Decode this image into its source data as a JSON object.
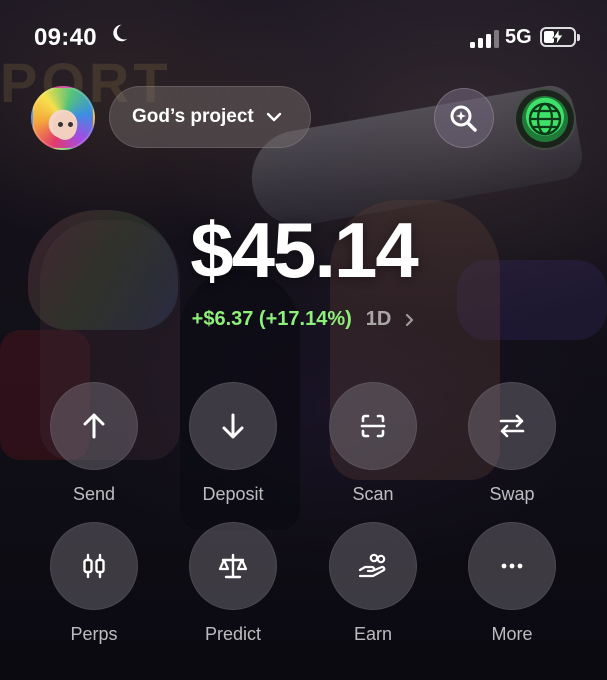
{
  "status_bar": {
    "time": "09:40",
    "network": "5G"
  },
  "header": {
    "project_label": "God’s project"
  },
  "portfolio": {
    "balance": "$45.14",
    "change": "+$6.37 (+17.14%)",
    "period": "1D"
  },
  "actions": [
    {
      "label": "Send",
      "icon": "arrow-up-icon"
    },
    {
      "label": "Deposit",
      "icon": "arrow-down-icon"
    },
    {
      "label": "Scan",
      "icon": "scan-icon"
    },
    {
      "label": "Swap",
      "icon": "swap-icon"
    },
    {
      "label": "Perps",
      "icon": "candlestick-icon"
    },
    {
      "label": "Predict",
      "icon": "scale-icon"
    },
    {
      "label": "Earn",
      "icon": "coins-hand-icon"
    },
    {
      "label": "More",
      "icon": "more-dots-icon"
    }
  ],
  "colors": {
    "positive": "#8ef07a",
    "globe_green": "#3fe06a"
  }
}
